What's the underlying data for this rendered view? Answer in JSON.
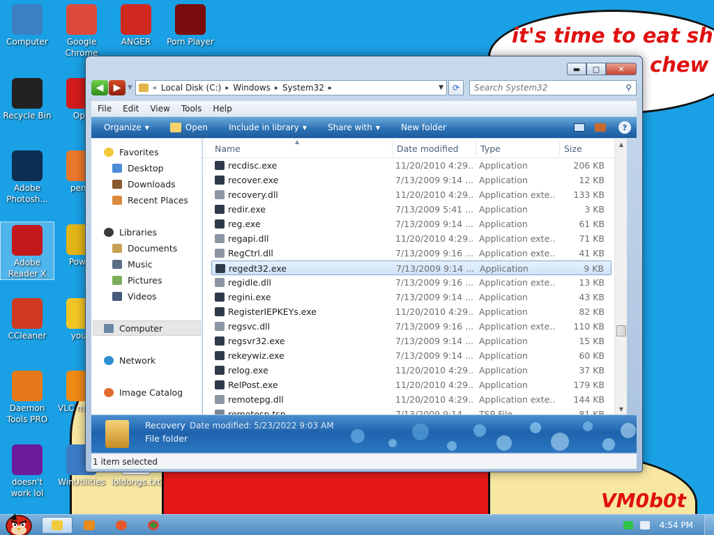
{
  "wallpaper": {
    "speech_line1": "it's time to eat shit",
    "speech_line2": "chew",
    "watermark": "VM0b0t"
  },
  "desktop_icons": [
    {
      "label": "Computer",
      "icon": "computer-icon",
      "color": "#3d7fc4"
    },
    {
      "label": "Google Chrome",
      "icon": "chrome-icon",
      "color": "#dd4a3a"
    },
    {
      "label": "ANGER",
      "icon": "angry-bird-icon",
      "color": "#d02a20"
    },
    {
      "label": "Porn Player",
      "icon": "flash-icon",
      "color": "#7a0d0d"
    },
    {
      "label": "Recycle Bin",
      "icon": "recycle-bin-icon",
      "color": "#222222"
    },
    {
      "label": "Ope",
      "icon": "opera-icon",
      "color": "#d11b1b"
    },
    {
      "label": "Adobe Photosh...",
      "icon": "photoshop-icon",
      "color": "#0d2d52"
    },
    {
      "label": "penis",
      "icon": "firefox-icon",
      "color": "#e8772a"
    },
    {
      "label": "Adobe Reader X",
      "icon": "adobe-reader-icon",
      "color": "#c4181c"
    },
    {
      "label": "Power",
      "icon": "dvd-icon",
      "color": "#e2b417"
    },
    {
      "label": "CCleaner",
      "icon": "ccleaner-icon",
      "color": "#d13a22"
    },
    {
      "label": "you t",
      "icon": "star-icon",
      "color": "#f2c524"
    },
    {
      "label": "Daemon Tools PRO",
      "icon": "daemon-tools-icon",
      "color": "#e67a1a"
    },
    {
      "label": "VLC m play",
      "icon": "vlc-icon",
      "color": "#f08a13"
    },
    {
      "label": "doesn't work lol",
      "icon": "yahoo-icon",
      "color": "#6a1c9c"
    },
    {
      "label": "WinUtilities",
      "icon": "winutilities-icon",
      "color": "#3b7cc7"
    },
    {
      "label": "loldongs.txt",
      "icon": "text-file-icon",
      "color": "#ffffff"
    }
  ],
  "window": {
    "breadcrumbs": [
      "Local Disk (C:)",
      "Windows",
      "System32"
    ],
    "search_placeholder": "Search System32",
    "menu": [
      "File",
      "Edit",
      "View",
      "Tools",
      "Help"
    ],
    "toolbar": {
      "organize": "Organize",
      "open": "Open",
      "include": "Include in library",
      "share": "Share with",
      "new_folder": "New folder"
    },
    "nav": {
      "favorites": "Favorites",
      "desktop": "Desktop",
      "downloads": "Downloads",
      "recent": "Recent Places",
      "libraries": "Libraries",
      "documents": "Documents",
      "music": "Music",
      "pictures": "Pictures",
      "videos": "Videos",
      "computer": "Computer",
      "network": "Network",
      "image_catalog": "Image Catalog"
    },
    "columns": {
      "name": "Name",
      "date": "Date modified",
      "type": "Type",
      "size": "Size"
    },
    "files": [
      {
        "name": "recdisc.exe",
        "date": "11/20/2010 4:29...",
        "type": "Application",
        "size": "206 KB"
      },
      {
        "name": "recover.exe",
        "date": "7/13/2009 9:14 ...",
        "type": "Application",
        "size": "12 KB"
      },
      {
        "name": "recovery.dll",
        "date": "11/20/2010 4:29...",
        "type": "Application exte...",
        "size": "133 KB"
      },
      {
        "name": "redir.exe",
        "date": "7/13/2009 5:41 ...",
        "type": "Application",
        "size": "3 KB"
      },
      {
        "name": "reg.exe",
        "date": "7/13/2009 9:14 ...",
        "type": "Application",
        "size": "61 KB"
      },
      {
        "name": "regapi.dll",
        "date": "11/20/2010 4:29...",
        "type": "Application exte...",
        "size": "71 KB"
      },
      {
        "name": "RegCtrl.dll",
        "date": "7/13/2009 9:16 ...",
        "type": "Application exte...",
        "size": "41 KB"
      },
      {
        "name": "regedt32.exe",
        "date": "7/13/2009 9:14 ...",
        "type": "Application",
        "size": "9 KB"
      },
      {
        "name": "regidle.dll",
        "date": "7/13/2009 9:16 ...",
        "type": "Application exte...",
        "size": "13 KB"
      },
      {
        "name": "regini.exe",
        "date": "7/13/2009 9:14 ...",
        "type": "Application",
        "size": "43 KB"
      },
      {
        "name": "RegisterIEPKEYs.exe",
        "date": "11/20/2010 4:29...",
        "type": "Application",
        "size": "82 KB"
      },
      {
        "name": "regsvc.dll",
        "date": "7/13/2009 9:16 ...",
        "type": "Application exte...",
        "size": "110 KB"
      },
      {
        "name": "regsvr32.exe",
        "date": "7/13/2009 9:14 ...",
        "type": "Application",
        "size": "15 KB"
      },
      {
        "name": "rekeywiz.exe",
        "date": "7/13/2009 9:14 ...",
        "type": "Application",
        "size": "60 KB"
      },
      {
        "name": "relog.exe",
        "date": "11/20/2010 4:29...",
        "type": "Application",
        "size": "37 KB"
      },
      {
        "name": "RelPost.exe",
        "date": "11/20/2010 4:29...",
        "type": "Application",
        "size": "179 KB"
      },
      {
        "name": "remotepg.dll",
        "date": "11/20/2010 4:29...",
        "type": "Application exte...",
        "size": "144 KB"
      },
      {
        "name": "remotesp.tsp",
        "date": "7/13/2009 9:14 ...",
        "type": "TSP File",
        "size": "81 KB"
      }
    ],
    "details": {
      "name": "Recovery",
      "modified_label": "Date modified:",
      "modified_value": "5/23/2022 9:03 AM",
      "kind": "File folder"
    },
    "status": "1 item selected"
  },
  "taskbar": {
    "clock": "4:54 PM"
  }
}
